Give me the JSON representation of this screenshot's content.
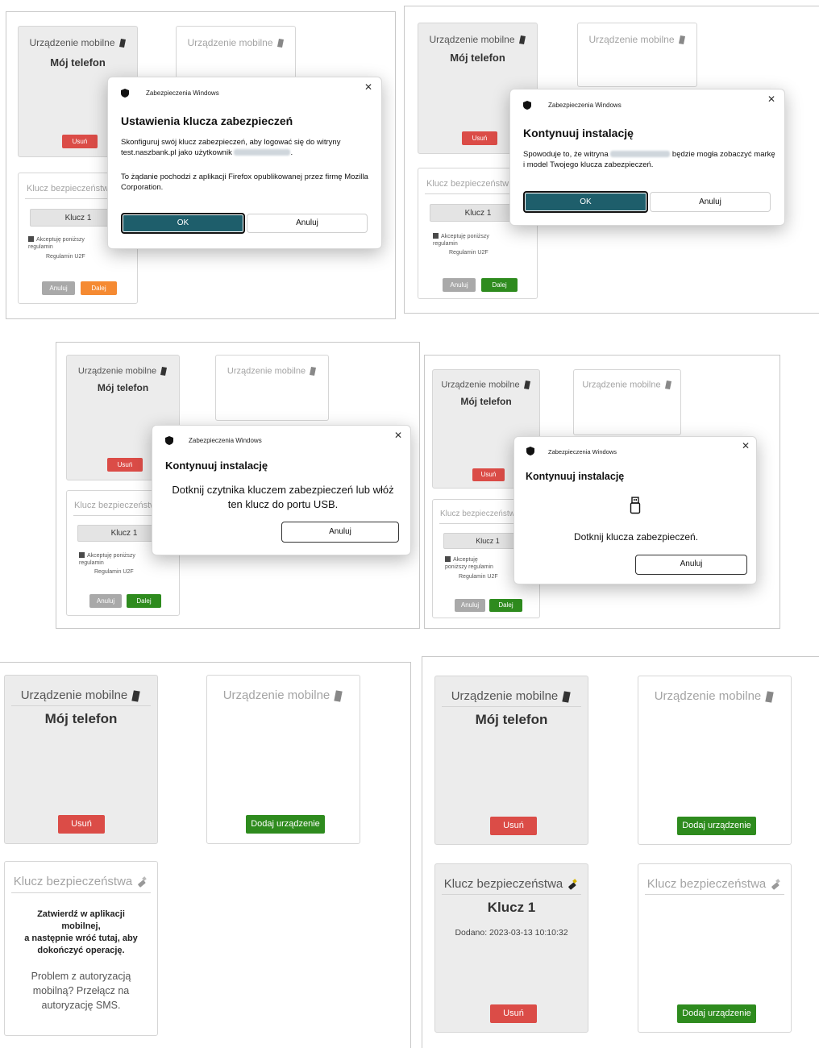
{
  "labels": {
    "mobile_device": "Urządzenie mobilne",
    "my_phone": "Mój telefon",
    "remove": "Usuń",
    "add_device": "Dodaj urządzenie",
    "security_key": "Klucz bezpieczeństwa",
    "security_key_cut": "Klucz bezpieczeństw",
    "security_key_cut2": "Klucz bezpieczeństwa",
    "key1": "Klucz 1",
    "accept_terms": "Akceptuję poniższy regulamin",
    "terms_link": "Regulamin U2F",
    "cancel": "Anuluj",
    "next": "Dalej",
    "win_security": "Zabezpieczenia Windows",
    "ok": "OK"
  },
  "dialog1": {
    "title": "Ustawienia klucza zabezpieczeń",
    "text1_a": "Skonfiguruj swój klucz zabezpieczeń, aby logować się do witryny test.naszbank.pl jako użytkownik",
    "text1_b": ".",
    "text2": "To żądanie pochodzi z aplikacji Firefox opublikowanej przez firmę Mozilla Corporation."
  },
  "dialog2": {
    "title": "Kontynuuj instalację",
    "text_a": "Spowoduje to, że witryna",
    "text_b": "będzie mogła zobaczyć markę i model Twojego klucza zabezpieczeń."
  },
  "dialog3": {
    "title": "Kontynuuj instalację",
    "text": "Dotknij czytnika kluczem zabezpieczeń lub włóż ten klucz do portu USB."
  },
  "dialog4": {
    "title": "Kontynuuj instalację",
    "text": "Dotknij klucza zabezpieczeń."
  },
  "panel5": {
    "confirm_l1": "Zatwierdź w aplikacji",
    "confirm_l2": "mobilnej,",
    "confirm_l3": "a następnie wróć tutaj, aby",
    "confirm_l4": "dokończyć operację.",
    "problem_l1": "Problem z autoryzacją",
    "problem_l2": "mobilną? Przełącz na",
    "problem_l3": "autoryzację SMS."
  },
  "panel6": {
    "added_label": "Dodano: 2023-03-13 10:10:32"
  },
  "colors": {
    "red": "#db4c47",
    "green": "#2e8b1e",
    "orange": "#f58a32",
    "ok_blue": "#1e5e6b"
  }
}
